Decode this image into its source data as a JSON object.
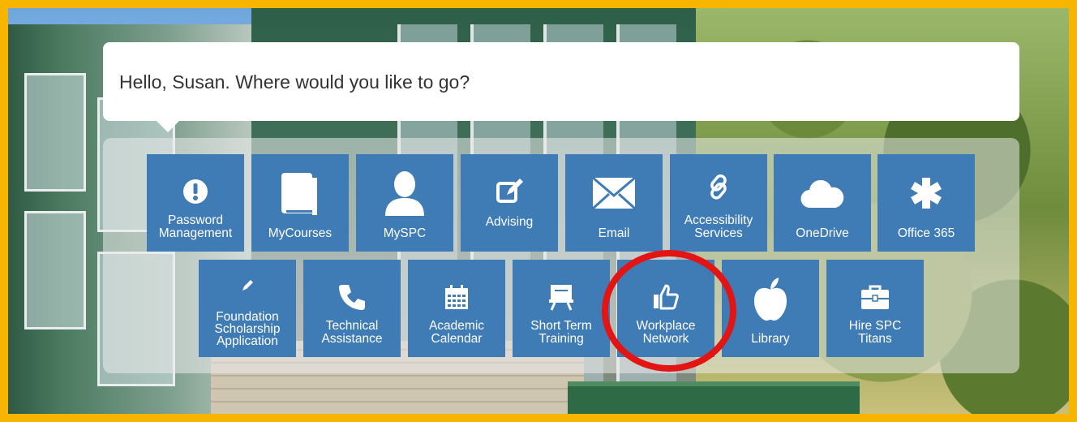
{
  "greeting": "Hello, Susan. Where would you like to go?",
  "tiles_row1": [
    {
      "label_line1": "Password",
      "label_line2": "Management",
      "icon": "exclamation-circle-icon"
    },
    {
      "label_line1": "",
      "label_line2": "MyCourses",
      "icon": "book-icon"
    },
    {
      "label_line1": "",
      "label_line2": "MySPC",
      "icon": "user-icon"
    },
    {
      "label_line1": "",
      "label_line2": "Advising",
      "icon": "edit-icon"
    },
    {
      "label_line1": "",
      "label_line2": "Email",
      "icon": "envelope-icon"
    },
    {
      "label_line1": "Accessibility",
      "label_line2": "Services",
      "icon": "link-icon"
    },
    {
      "label_line1": "",
      "label_line2": "OneDrive",
      "icon": "cloud-icon"
    },
    {
      "label_line1": "",
      "label_line2": "Office 365",
      "icon": "asterisk-icon"
    }
  ],
  "tiles_row2": [
    {
      "label_line1": "Foundation",
      "label_line2": "Scholarship",
      "label_line3": "Application",
      "icon": "pencil-icon"
    },
    {
      "label_line1": "Technical",
      "label_line2": "Assistance",
      "icon": "phone-icon"
    },
    {
      "label_line1": "Academic",
      "label_line2": "Calendar",
      "icon": "calendar-icon"
    },
    {
      "label_line1": "Short Term",
      "label_line2": "Training",
      "icon": "presentation-icon"
    },
    {
      "label_line1": "Workplace",
      "label_line2": "Network",
      "icon": "thumbs-up-icon"
    },
    {
      "label_line1": "",
      "label_line2": "Library",
      "icon": "apple-icon"
    },
    {
      "label_line1": "Hire SPC",
      "label_line2": "Titans",
      "icon": "briefcase-icon"
    }
  ],
  "colors": {
    "tile": "#3f7bb4",
    "frame": "#f7b500",
    "highlight_ring": "#e21414"
  }
}
